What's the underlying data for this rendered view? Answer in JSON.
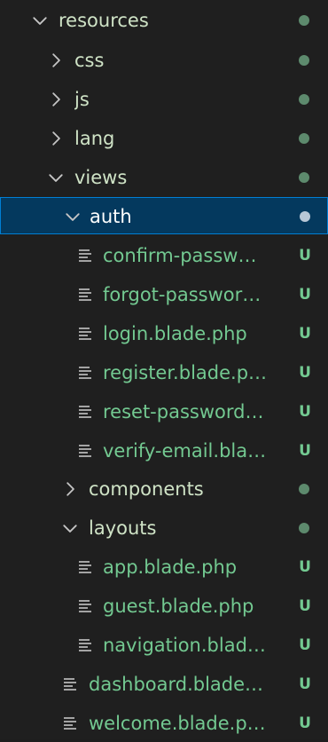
{
  "colors": {
    "background": "#1f1f1f",
    "folder_text": "#cfe3c6",
    "untracked_text": "#73c991",
    "git_dot": "#5d8a6d",
    "selected_dot": "#b8c7d6",
    "selected_text": "#ffffff",
    "twisty": "#c5c5c5",
    "selection_bg": "#04395e",
    "selection_border": "#007fd4"
  },
  "icons": {
    "expanded": "chevron-down-icon",
    "collapsed": "chevron-right-icon",
    "file": "lines-file-icon"
  },
  "tree": [
    {
      "label": "resources",
      "kind": "folder",
      "expanded": true,
      "status": "dot",
      "selected": false
    },
    {
      "label": "css",
      "kind": "folder",
      "expanded": false,
      "status": "dot",
      "selected": false
    },
    {
      "label": "js",
      "kind": "folder",
      "expanded": false,
      "status": "dot",
      "selected": false
    },
    {
      "label": "lang",
      "kind": "folder",
      "expanded": false,
      "status": "dot",
      "selected": false
    },
    {
      "label": "views",
      "kind": "folder",
      "expanded": true,
      "status": "dot",
      "selected": false
    },
    {
      "label": "auth",
      "kind": "folder",
      "expanded": true,
      "status": "dot",
      "selected": true
    },
    {
      "label": "confirm-passw…",
      "kind": "file",
      "status": "U",
      "selected": false
    },
    {
      "label": "forgot-passwor…",
      "kind": "file",
      "status": "U",
      "selected": false
    },
    {
      "label": "login.blade.php",
      "kind": "file",
      "status": "U",
      "selected": false
    },
    {
      "label": "register.blade.p…",
      "kind": "file",
      "status": "U",
      "selected": false
    },
    {
      "label": "reset-password…",
      "kind": "file",
      "status": "U",
      "selected": false
    },
    {
      "label": "verify-email.bla…",
      "kind": "file",
      "status": "U",
      "selected": false
    },
    {
      "label": "components",
      "kind": "folder",
      "expanded": false,
      "status": "dot",
      "selected": false
    },
    {
      "label": "layouts",
      "kind": "folder",
      "expanded": true,
      "status": "dot",
      "selected": false
    },
    {
      "label": "app.blade.php",
      "kind": "file",
      "status": "U",
      "selected": false
    },
    {
      "label": "guest.blade.php",
      "kind": "file",
      "status": "U",
      "selected": false
    },
    {
      "label": "navigation.blad…",
      "kind": "file",
      "status": "U",
      "selected": false
    },
    {
      "label": "dashboard.blade…",
      "kind": "file",
      "status": "U",
      "selected": false
    },
    {
      "label": "welcome.blade.p…",
      "kind": "file",
      "status": "U",
      "selected": false
    }
  ]
}
